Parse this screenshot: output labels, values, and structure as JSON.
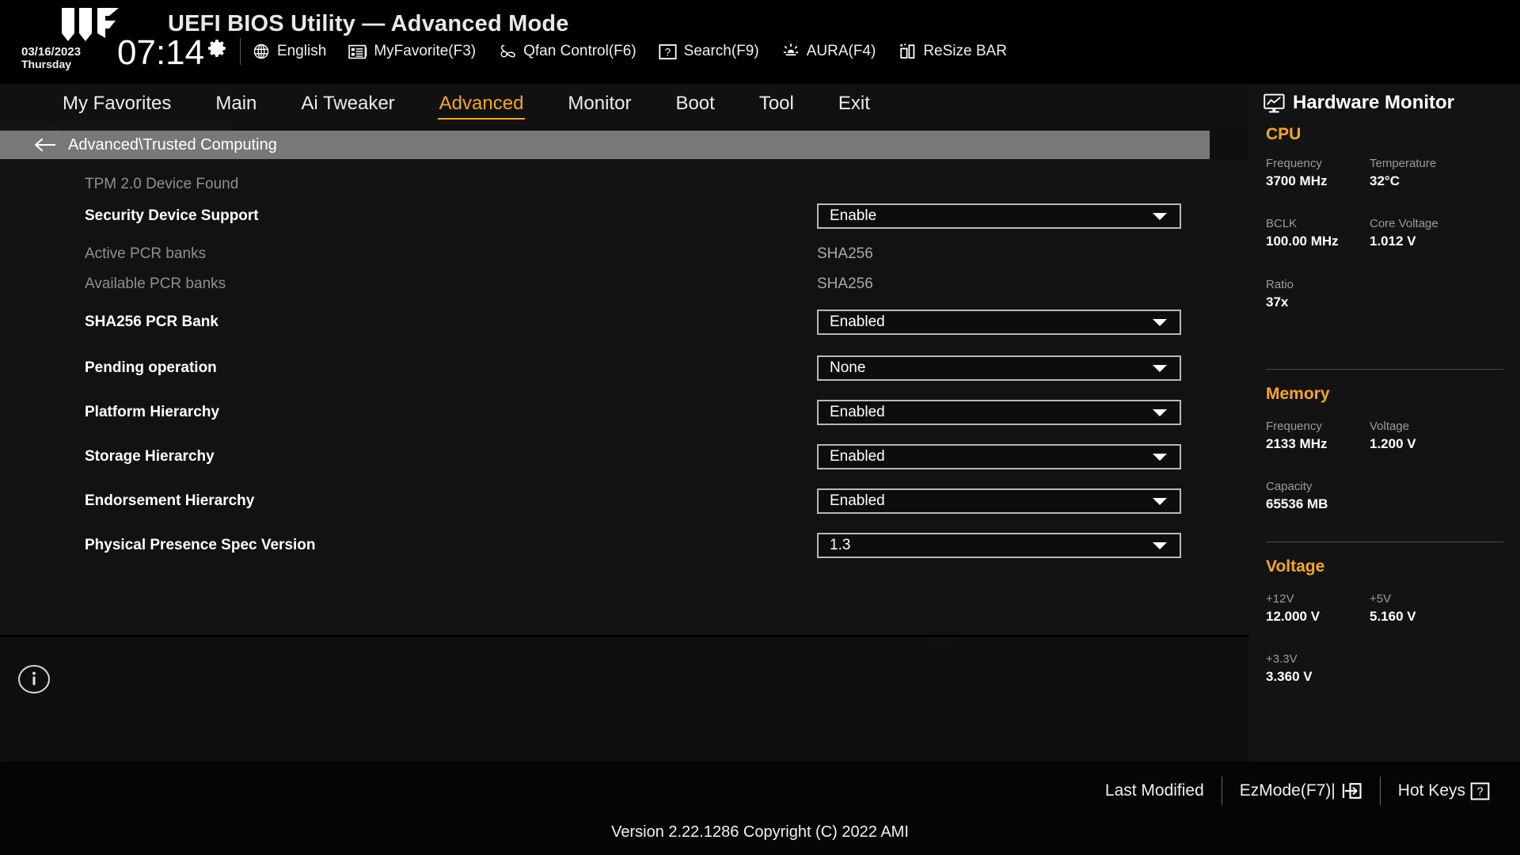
{
  "header": {
    "title": "UEFI BIOS Utility — Advanced Mode",
    "logo_name": "tuf-gaming-logo",
    "date": "03/16/2023",
    "weekday": "Thursday",
    "time": "07:14",
    "gear_icon": "gear-icon",
    "toolbar": [
      {
        "label": "English",
        "icon": "globe-icon"
      },
      {
        "label": "MyFavorite(F3)",
        "icon": "favorites-list-icon"
      },
      {
        "label": "Qfan Control(F6)",
        "icon": "fan-icon"
      },
      {
        "label": "Search(F9)",
        "icon": "question-box-icon"
      },
      {
        "label": "AURA(F4)",
        "icon": "aura-light-icon"
      },
      {
        "label": "ReSize BAR",
        "icon": "resize-bar-icon"
      }
    ]
  },
  "nav": {
    "tabs": [
      {
        "label": "My Favorites",
        "active": false
      },
      {
        "label": "Main",
        "active": false
      },
      {
        "label": "Ai Tweaker",
        "active": false
      },
      {
        "label": "Advanced",
        "active": true
      },
      {
        "label": "Monitor",
        "active": false
      },
      {
        "label": "Boot",
        "active": false
      },
      {
        "label": "Tool",
        "active": false
      },
      {
        "label": "Exit",
        "active": false
      }
    ],
    "active_color": "#f5a623"
  },
  "breadcrumb": {
    "back_icon": "arrow-left-icon",
    "path": "Advanced\\Trusted Computing"
  },
  "settings": [
    {
      "label": "TPM 2.0 Device Found",
      "type": "static-heading",
      "value": "",
      "dim": true
    },
    {
      "label": "Security Device Support",
      "type": "dropdown",
      "value": "Enable",
      "dim": false
    },
    {
      "label": "Active PCR banks",
      "type": "readonly",
      "value": "SHA256",
      "dim": true
    },
    {
      "label": "Available PCR banks",
      "type": "readonly",
      "value": "SHA256",
      "dim": true
    },
    {
      "label": "SHA256 PCR Bank",
      "type": "dropdown",
      "value": "Enabled",
      "dim": false
    },
    {
      "label": "Pending operation",
      "type": "dropdown",
      "value": "None",
      "dim": false
    },
    {
      "label": "Platform Hierarchy",
      "type": "dropdown",
      "value": "Enabled",
      "dim": false
    },
    {
      "label": "Storage Hierarchy",
      "type": "dropdown",
      "value": "Enabled",
      "dim": false
    },
    {
      "label": "Endorsement Hierarchy",
      "type": "dropdown",
      "value": "Enabled",
      "dim": false
    },
    {
      "label": "Physical Presence Spec Version",
      "type": "dropdown",
      "value": "1.3",
      "dim": false
    }
  ],
  "info_button": {
    "icon": "info-circle-icon"
  },
  "sidebar": {
    "title": "Hardware Monitor",
    "title_icon": "monitor-chart-icon",
    "sections": [
      {
        "name": "CPU",
        "rows": [
          [
            {
              "key": "Frequency",
              "value": "3700 MHz"
            },
            {
              "key": "Temperature",
              "value": "32°C"
            }
          ],
          [
            {
              "key": "BCLK",
              "value": "100.00 MHz"
            },
            {
              "key": "Core Voltage",
              "value": "1.012 V"
            }
          ],
          [
            {
              "key": "Ratio",
              "value": "37x"
            }
          ]
        ]
      },
      {
        "name": "Memory",
        "rows": [
          [
            {
              "key": "Frequency",
              "value": "2133 MHz"
            },
            {
              "key": "Voltage",
              "value": "1.200 V"
            }
          ],
          [
            {
              "key": "Capacity",
              "value": "65536 MB"
            }
          ]
        ]
      },
      {
        "name": "Voltage",
        "rows": [
          [
            {
              "key": "+12V",
              "value": "12.000 V"
            },
            {
              "key": "+5V",
              "value": "5.160 V"
            }
          ],
          [
            {
              "key": "+3.3V",
              "value": "3.360 V"
            }
          ]
        ]
      }
    ],
    "accent_color": "#f5a623"
  },
  "footer": {
    "actions": [
      {
        "label": "Last Modified",
        "icon": ""
      },
      {
        "label": "EzMode(F7)|",
        "icon": "enter-arrow-icon"
      },
      {
        "label": "Hot Keys",
        "icon": "question-box-icon"
      }
    ],
    "version": "Version 2.22.1286 Copyright (C) 2022 AMI"
  }
}
